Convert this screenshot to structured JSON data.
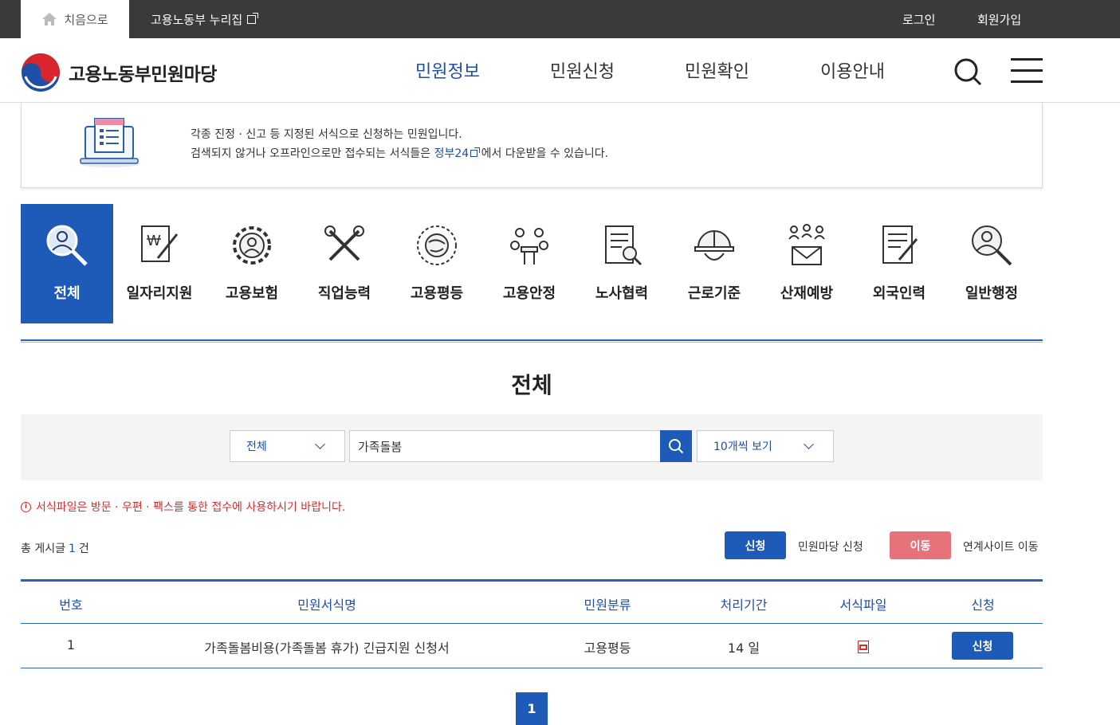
{
  "topbar": {
    "home": "치음으로",
    "nuri": "고용노동부 누리집",
    "login": "로그인",
    "join": "회원가입"
  },
  "header": {
    "logo": "고용노동부민원마당",
    "nav": [
      "민원정보",
      "민원신청",
      "민원확인",
      "이용안내"
    ],
    "active_nav": "민원정보"
  },
  "info": {
    "line1": "각종 진정 · 신고 등 지정된 서식으로 신청하는 민원입니다.",
    "line2_prefix": "검색되지 않거나 오프라인으로만 접수되는 서식들은",
    "line2_link": "정부24",
    "line2_suffix": "에서 다운받을 수 있습니다."
  },
  "categories": [
    {
      "label": "전체",
      "icon": "person-magnifier-icon",
      "active": true
    },
    {
      "label": "일자리지원",
      "icon": "won-document-pen-icon"
    },
    {
      "label": "고용보험",
      "icon": "gear-person-icon"
    },
    {
      "label": "직업능력",
      "icon": "tools-icon"
    },
    {
      "label": "고용평등",
      "icon": "globe-arrows-icon"
    },
    {
      "label": "고용안정",
      "icon": "meeting-icon"
    },
    {
      "label": "노사협력",
      "icon": "document-check-icon"
    },
    {
      "label": "근로기준",
      "icon": "hardhat-icon"
    },
    {
      "label": "산재예방",
      "icon": "people-envelope-icon"
    },
    {
      "label": "외국인력",
      "icon": "form-pen-icon"
    },
    {
      "label": "일반행정",
      "icon": "person-magnifier-icon"
    }
  ],
  "section_title": "전체",
  "search": {
    "scope": "전체",
    "keyword": "가족돌봄",
    "page_size": "10개씩 보기"
  },
  "notice": "서식파일은 방문 · 우편 · 팩스를 통한 접수에 사용하시기 바랍니다.",
  "total": {
    "prefix": "총 게시글",
    "count": "1",
    "suffix": "건"
  },
  "legend": {
    "apply_label": "신청",
    "apply_desc": "민원마당 신청",
    "move_label": "이동",
    "move_desc": "연계사이트 이동"
  },
  "table": {
    "headers": [
      "번호",
      "민원서식명",
      "민원분류",
      "처리기간",
      "서식파일",
      "신청"
    ],
    "rows": [
      {
        "no": "1",
        "name": "가족돌봄비용(가족돌봄 휴가) 긴급지원 신청서",
        "category": "고용평등",
        "period": "14 일",
        "apply": "신청"
      }
    ]
  },
  "pagination": {
    "current": "1"
  },
  "colors": {
    "primary": "#1e5bb8",
    "move": "#e8727a",
    "notice": "#d32f2f",
    "topbar": "#3a3a3a"
  }
}
